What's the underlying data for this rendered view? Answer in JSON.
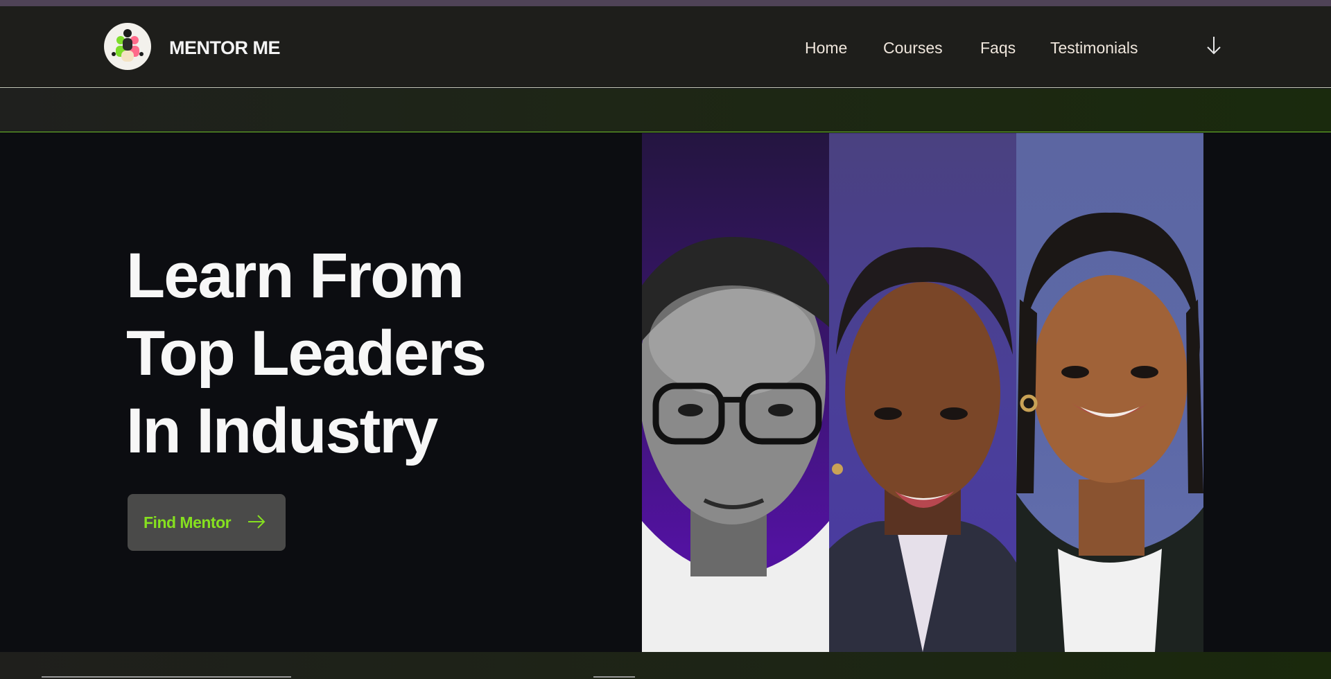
{
  "brand": {
    "name": "MENTOR ME",
    "logo_icon": "mentor-group-logo-icon"
  },
  "nav": {
    "items": [
      {
        "label": "Home"
      },
      {
        "label": "Courses"
      },
      {
        "label": "Faqs"
      },
      {
        "label": "Testimonials"
      }
    ],
    "scroll_icon": "arrow-down-icon"
  },
  "hero": {
    "headline_lines": [
      "Learn From",
      "Top Leaders",
      "In Industry"
    ],
    "cta": {
      "label": "Find Mentor",
      "icon": "arrow-right-icon"
    },
    "portraits": [
      {
        "name": "mentor-portrait-1"
      },
      {
        "name": "mentor-portrait-2"
      },
      {
        "name": "mentor-portrait-3"
      }
    ]
  },
  "colors": {
    "accent": "#86e01f",
    "nav_background": "#1e1e1b",
    "hero_background": "#0c0d11",
    "button_background": "#4a4a49"
  }
}
